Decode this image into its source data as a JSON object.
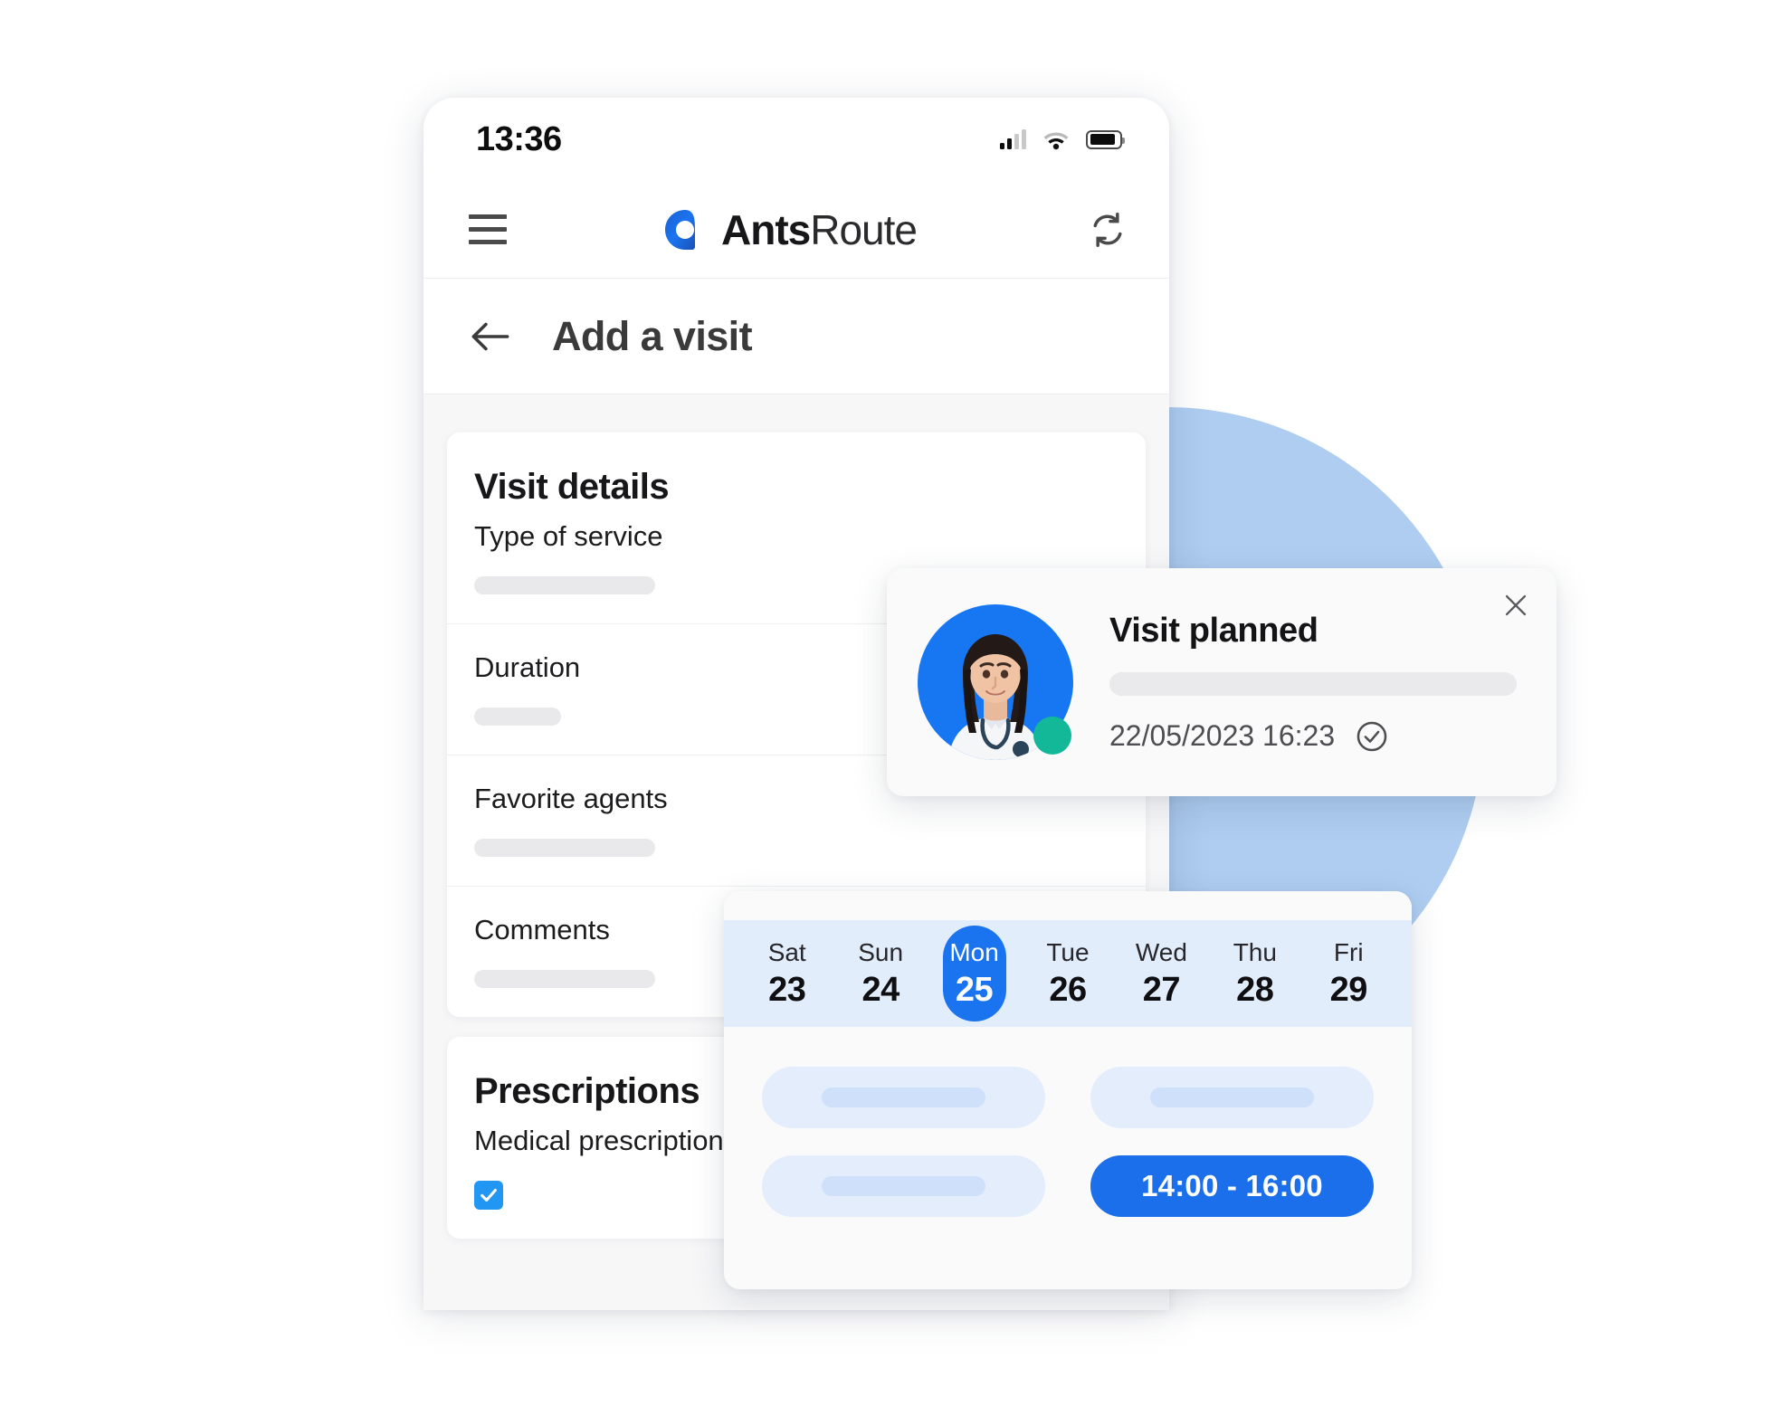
{
  "phone": {
    "status_bar": {
      "time": "13:36",
      "signal_icon": "signal-bars-icon",
      "wifi_icon": "wifi-icon",
      "battery_icon": "battery-icon"
    },
    "app_bar": {
      "menu_icon": "hamburger-menu-icon",
      "brand_mark_icon": "antsroute-logo-icon",
      "brand_bold": "Ants",
      "brand_light": "Route",
      "sync_icon": "sync-refresh-icon"
    },
    "screen": {
      "back_icon": "back-arrow-icon",
      "title": "Add a visit"
    },
    "visit_details": {
      "title": "Visit details",
      "fields": [
        {
          "label": "Type of service",
          "value": ""
        },
        {
          "label": "Duration",
          "value": ""
        },
        {
          "label": "Favorite agents",
          "value": ""
        },
        {
          "label": "Comments",
          "value": ""
        }
      ]
    },
    "prescriptions": {
      "title": "Prescriptions",
      "item_label": "Medical prescription",
      "checked": true,
      "check_icon": "checkmark-icon"
    }
  },
  "notification": {
    "title": "Visit planned",
    "timestamp": "22/05/2023 16:23",
    "status_icon": "check-circle-icon",
    "close_icon": "close-icon",
    "avatar_icon": "doctor-avatar",
    "online_icon": "online-status-dot"
  },
  "calendar": {
    "days": [
      {
        "dow": "Sat",
        "num": "23",
        "selected": false
      },
      {
        "dow": "Sun",
        "num": "24",
        "selected": false
      },
      {
        "dow": "Mon",
        "num": "25",
        "selected": true
      },
      {
        "dow": "Tue",
        "num": "26",
        "selected": false
      },
      {
        "dow": "Wed",
        "num": "27",
        "selected": false
      },
      {
        "dow": "Thu",
        "num": "28",
        "selected": false
      },
      {
        "dow": "Fri",
        "num": "29",
        "selected": false
      }
    ],
    "slots": [
      {
        "label": "",
        "selected": false
      },
      {
        "label": "",
        "selected": false
      },
      {
        "label": "",
        "selected": false
      },
      {
        "label": "14:00 - 16:00",
        "selected": true
      }
    ]
  },
  "colors": {
    "brand_blue": "#1777f2",
    "selected_blue": "#1b74ef",
    "slot_blue": "#1b6fea",
    "slot_bg": "#e3edfc",
    "strip_bg": "#e2edfc",
    "bg_circle": "#aecdf0",
    "online_green": "#12b897",
    "checkbox_blue": "#2196f3"
  }
}
